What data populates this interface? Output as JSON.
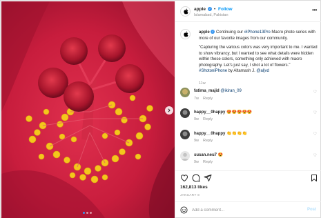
{
  "post": {
    "username": "apple",
    "follow_label": "Follow",
    "separator": "•",
    "location": "Islamabad, Pakistan",
    "image_dots": 3,
    "active_dot": 0
  },
  "caption": {
    "username": "apple",
    "text_1": "Continuing our",
    "hashtag_1": "#iPhone13Pro",
    "text_2": "Macro photo series with more of our favorite images from our community.",
    "quote": "\"Capturing the various colors was very important to me. I wanted to show vibrancy, but I wanted to see what details were hidden within these colors, something only achieved with macro photography. Let's just say, I shot a lot of flowers.\"",
    "hashtag_2": "#ShotoniPhone",
    "by_text": "by Altamash J.",
    "mention": "@aljvd",
    "time": "11w"
  },
  "comments": [
    {
      "username": "fatima_majid",
      "text": "@ikiran_09",
      "time": "7w",
      "reply": "Reply"
    },
    {
      "username": "happy__0happy",
      "text": "😍😍😍😍😍",
      "time": "9w",
      "reply": "Reply"
    },
    {
      "username": "happy__0happy",
      "text": "👏👏👏👏",
      "time": "9w",
      "reply": "Reply"
    },
    {
      "username": "susan.neu7",
      "text": "😍",
      "time": "9w",
      "reply": "Reply"
    }
  ],
  "stats": {
    "likes": "162,813 likes",
    "date": "JANUARY 8"
  },
  "add_comment": {
    "placeholder": "Add a comment...",
    "post_label": "Post"
  },
  "icons": {
    "like": "heart-icon",
    "comment": "comment-icon",
    "share": "share-icon",
    "save": "bookmark-icon",
    "emoji": "emoji-icon",
    "next": "chevron-right-icon",
    "more": "more-options-icon"
  },
  "colors": {
    "accent": "#0095f6",
    "verified": "#3897f0",
    "muted": "#8e8e8e",
    "link": "#00376b"
  }
}
